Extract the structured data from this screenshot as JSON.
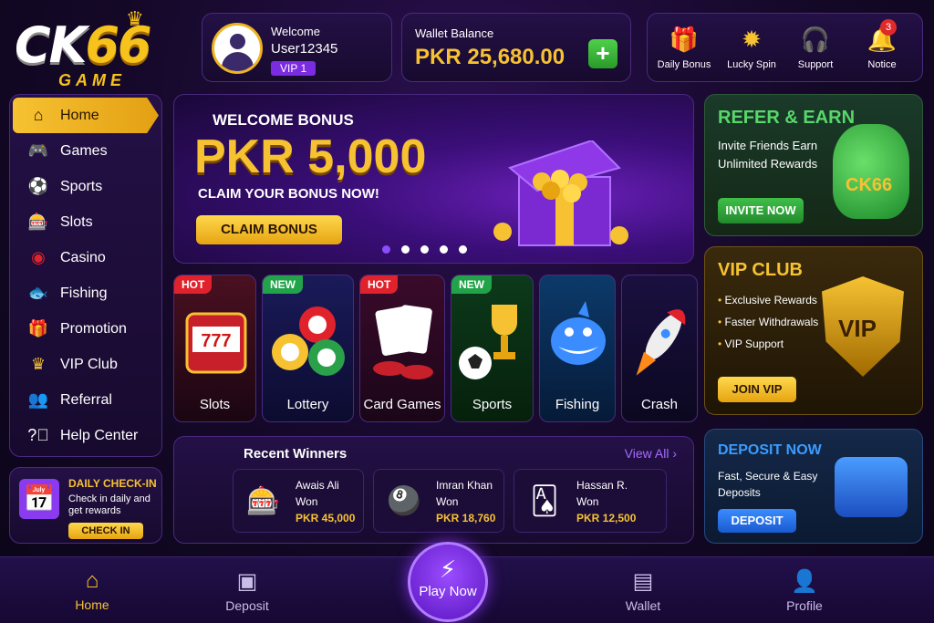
{
  "logo": {
    "ck": "CK",
    "sixtysix": "66",
    "game": "GAME"
  },
  "user": {
    "welcome": "Welcome",
    "name": "User12345",
    "vip": "VIP 1"
  },
  "wallet": {
    "label": "Wallet Balance",
    "amount": "PKR 25,680.00"
  },
  "quick_actions": [
    {
      "label": "Daily Bonus",
      "icon": "gift-icon"
    },
    {
      "label": "Lucky Spin",
      "icon": "wheel-icon"
    },
    {
      "label": "Support",
      "icon": "headset-icon"
    },
    {
      "label": "Notice",
      "icon": "bell-icon",
      "count": "3"
    }
  ],
  "sidebar": {
    "items": [
      {
        "label": "Home",
        "icon": "home-icon"
      },
      {
        "label": "Games",
        "icon": "gamepad-icon"
      },
      {
        "label": "Sports",
        "icon": "soccer-icon"
      },
      {
        "label": "Slots",
        "icon": "slots-icon"
      },
      {
        "label": "Casino",
        "icon": "chip-icon"
      },
      {
        "label": "Fishing",
        "icon": "fish-icon"
      },
      {
        "label": "Promotion",
        "icon": "gift-icon"
      },
      {
        "label": "VIP Club",
        "icon": "crown-icon"
      },
      {
        "label": "Referral",
        "icon": "users-icon"
      },
      {
        "label": "Help Center",
        "icon": "help-icon"
      }
    ]
  },
  "checkin": {
    "title": "DAILY CHECK-IN",
    "sub": "Check in daily and get rewards",
    "button": "CHECK IN"
  },
  "banner": {
    "title": "WELCOME BONUS",
    "amount": "PKR 5,000",
    "sub": "CLAIM YOUR BONUS NOW!",
    "button": "CLAIM BONUS",
    "slides": 5,
    "active_slide": 1
  },
  "games": [
    {
      "label": "Slots",
      "tag": "HOT"
    },
    {
      "label": "Lottery",
      "tag": "NEW"
    },
    {
      "label": "Card Games",
      "tag": "HOT"
    },
    {
      "label": "Sports",
      "tag": "NEW"
    },
    {
      "label": "Fishing",
      "tag": ""
    },
    {
      "label": "Crash",
      "tag": ""
    }
  ],
  "winners": {
    "title": "Recent Winners",
    "view_all": "View All",
    "list": [
      {
        "name": "Awais Ali",
        "won": "Won",
        "amount": "PKR 45,000"
      },
      {
        "name": "Imran Khan",
        "won": "Won",
        "amount": "PKR 18,760"
      },
      {
        "name": "Hassan R.",
        "won": "Won",
        "amount": "PKR 12,500"
      }
    ]
  },
  "refer": {
    "title": "REFER & EARN",
    "sub": "Invite Friends Earn Unlimited Rewards",
    "button": "INVITE NOW",
    "bag_label": "CK66"
  },
  "vip_club": {
    "title": "VIP CLUB",
    "perks": [
      "Exclusive Rewards",
      "Faster Withdrawals",
      "VIP Support"
    ],
    "button": "JOIN VIP",
    "badge": "VIP"
  },
  "deposit_card": {
    "title": "DEPOSIT NOW",
    "sub": "Fast, Secure & Easy Deposits",
    "button": "DEPOSIT"
  },
  "bottom_nav": {
    "items": [
      {
        "label": "Home",
        "icon": "home-icon"
      },
      {
        "label": "Deposit",
        "icon": "wallet-plus-icon"
      },
      {
        "label": "Wallet",
        "icon": "wallet-icon"
      },
      {
        "label": "Profile",
        "icon": "user-icon"
      }
    ],
    "play": "Play Now"
  },
  "colors": {
    "accent": "#f6c232",
    "purple": "#7b2be0",
    "green": "#3fbf4a",
    "blue": "#3a8cff"
  }
}
